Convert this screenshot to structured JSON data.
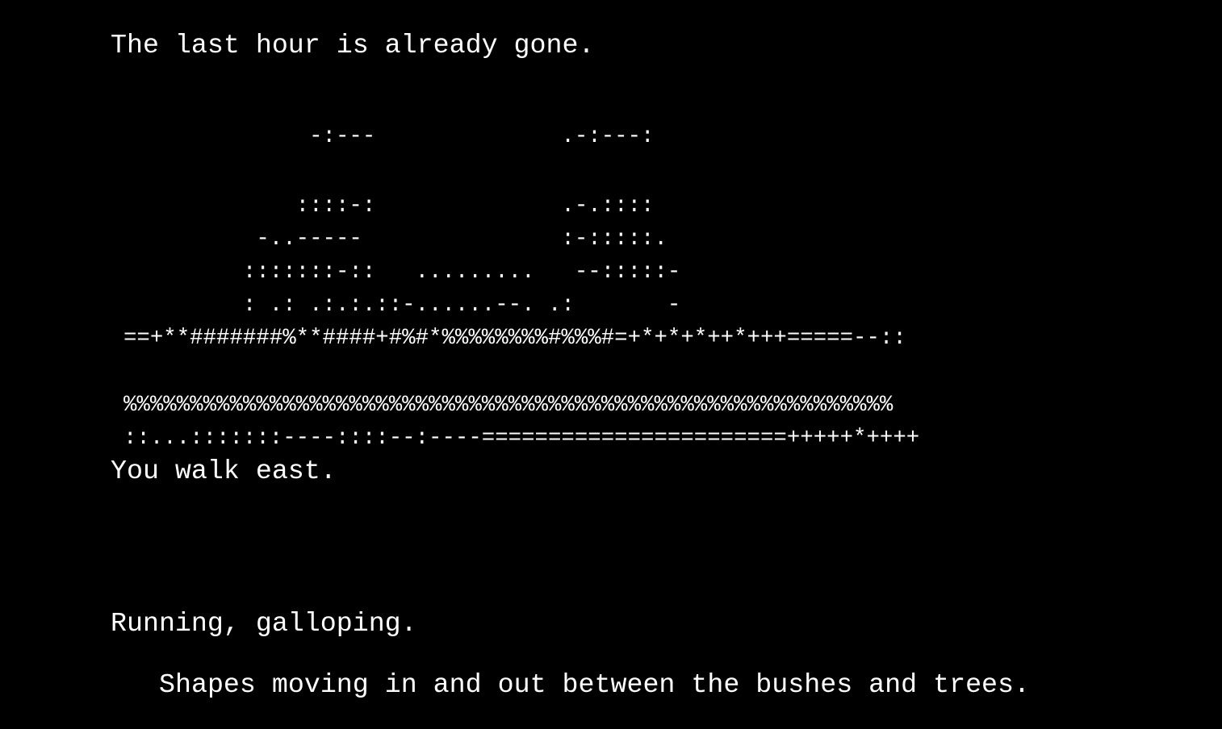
{
  "colors": {
    "background": "#000000",
    "text": "#ffffff"
  },
  "narration": {
    "opening": "The last hour is already gone.",
    "action": "You walk east.",
    "motion": "Running, galloping.",
    "description": "Shapes moving in and out between the bushes and trees."
  },
  "scene_art": {
    "lines": [
      "              -:---              .-:---:",
      "",
      "             ::::-:              .-.::::",
      "          -..-----               :-:::::.",
      "         :::::::-::   .........   --:::::-",
      "         : .: .:.:.::-......--. .:       -",
      "==+**#######%**####+#%#*%%%%%%%%#%%%#=+*+*+*++*+++=====--::",
      "",
      "%%%%%%%%%%%%%%%%%%%%%%%%%%%%%%%%%%%%%%%%%%%%%%%%%%%%%%%%%%",
      "::...:::::::----::::--:----=======================+++++*++++"
    ]
  }
}
